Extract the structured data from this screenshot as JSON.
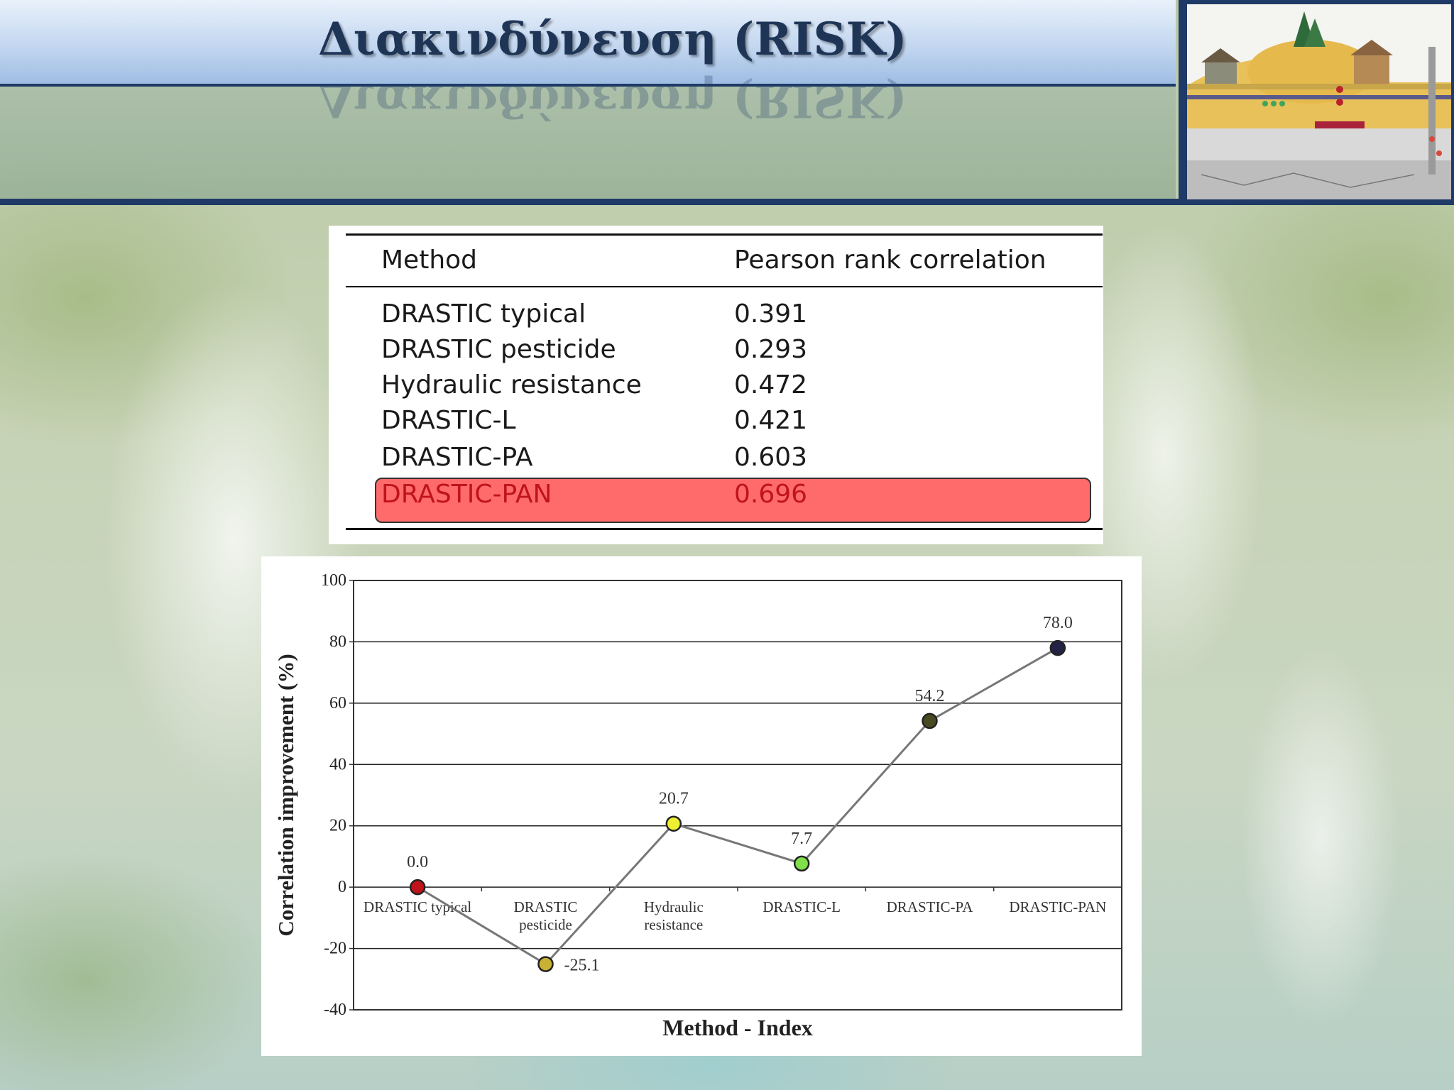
{
  "slide": {
    "title": "Διακινδύνευση (RISK)"
  },
  "table": {
    "headers": [
      "Method",
      "Pearson rank correlation"
    ],
    "rows": [
      {
        "method": "DRASTIC typical",
        "value": "0.391"
      },
      {
        "method": "DRASTIC pesticide",
        "value": "0.293"
      },
      {
        "method": "Hydraulic resistance",
        "value": "0.472"
      },
      {
        "method": "DRASTIC-L",
        "value": "0.421"
      },
      {
        "method": "DRASTIC-PA",
        "value": "0.603"
      },
      {
        "method": "DRASTIC-PAN",
        "value": "0.696"
      }
    ],
    "highlight_row": 5,
    "highlight_color": "#ff6b6b",
    "highlight_text_color": "#c0141a"
  },
  "chart_data": {
    "type": "line",
    "title": "",
    "xlabel": "Method - Index",
    "ylabel": "Correlation improvement (%)",
    "ylim": [
      -40,
      100
    ],
    "yticks": [
      100,
      80,
      60,
      40,
      20,
      0,
      -20,
      -40
    ],
    "grid": true,
    "categories": [
      [
        "DRASTIC typical"
      ],
      [
        "DRASTIC",
        "pesticide"
      ],
      [
        "Hydraulic",
        "resistance"
      ],
      [
        "DRASTIC-L"
      ],
      [
        "DRASTIC-PA"
      ],
      [
        "DRASTIC-PAN"
      ]
    ],
    "values": [
      0.0,
      -25.1,
      20.7,
      7.7,
      54.2,
      78.0
    ],
    "data_labels": [
      "0.0",
      "-25.1",
      "20.7",
      "7.7",
      "54.2",
      "78.0"
    ],
    "marker_colors": [
      "#c0141a",
      "#c9b233",
      "#eeee33",
      "#7fe04a",
      "#4a4a22",
      "#232346"
    ],
    "line_color": "#777777"
  }
}
